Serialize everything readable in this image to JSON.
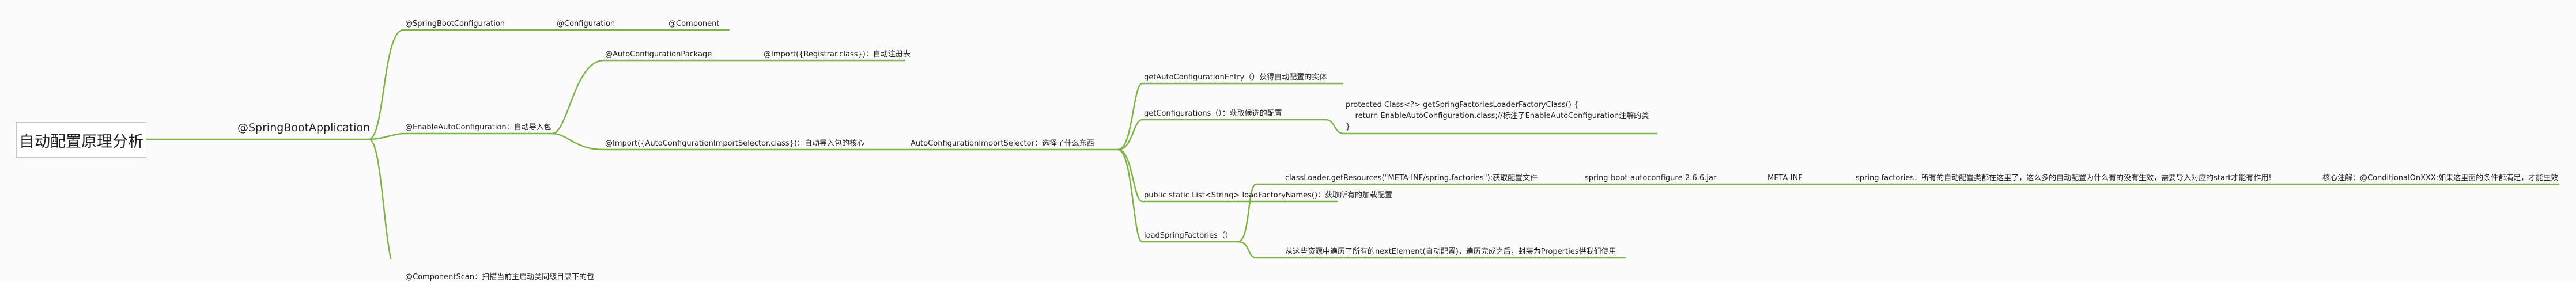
{
  "root": "自动配置原理分析",
  "level1": "@SpringBootApplication",
  "top_branch": {
    "config": "@SpringBootConfiguration",
    "configuration": "@Configuration",
    "component": "@Component"
  },
  "auto_config": {
    "label": "@EnableAutoConfiguration：自动导入包",
    "package": "@AutoConfigurationPackage",
    "registrar": "@Import({Registrar.class})：自动注册表",
    "selector_import": "@Import({AutoConfigurationImportSelector.class})：自动导入包的核心",
    "selector": "AutoConfigurationImportSelector：选择了什么东西"
  },
  "selector_children": {
    "get_entry": "getAutoConfigurationEntry（）获得自动配置的实体",
    "get_configs": "getConfigurations（）：获取候选的配置",
    "code": "protected Class<?> getSpringFactoriesLoaderFactoryClass() {\n    return EnableAutoConfiguration.class;//标注了EnableAutoConfiguration注解的类\n}",
    "load_names": "public static List<String> loadFactoryNames()：获取所有的加载配置",
    "load_factories": "loadSpringFactories（）"
  },
  "load_children": {
    "get_resources": "classLoader.getResources(\"META-INF/spring.factories\"):获取配置文件",
    "jar": "spring-boot-autoconfigure-2.6.6.jar",
    "meta_inf": "META-INF",
    "spring_factories": "spring.factories：所有的自动配置类都在这里了，这么多的自动配置为什么有的没有生效，需要导入对应的start才能有作用!",
    "core_note": "核心注解：@ConditionalOnXXX:如果这里面的条件都满足，才能生效",
    "traverse": "从这些资源中遍历了所有的nextElement(自动配置)，遍历完成之后，封装为Properties供我们使用"
  },
  "component_scan": "@ComponentScan：扫描当前主启动类同级目录下的包",
  "colors": {
    "branch_green": "#7cb342",
    "root_border": "#c8c8c8",
    "background": "#fbfbfb"
  }
}
